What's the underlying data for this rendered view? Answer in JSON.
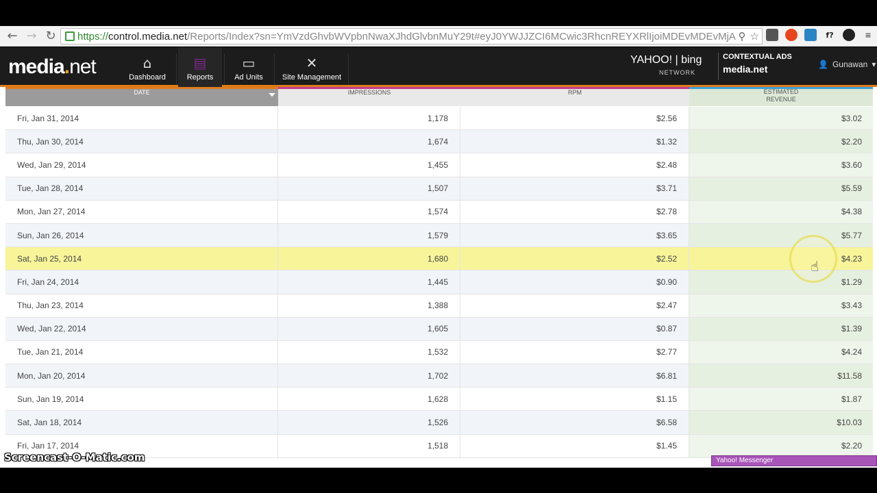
{
  "browser": {
    "url_scheme": "https://",
    "url_host": "control.media.net",
    "url_path": "/Reports/Index?sn=YmVzdGhvbWVpbnNwaXJhdGlvbnMuY29t#eyJ0YWJJZCI6MCwic3RhcnREYXRlIjoiMDEvMDEvMjAxN",
    "back_icon": "←",
    "forward_icon": "→",
    "reload_icon": "↻",
    "search_icon": "⚲",
    "star_icon": "☆"
  },
  "header": {
    "logo_text": "media",
    "logo_dot": ".",
    "logo_net": "net",
    "nav": [
      {
        "label": "Dashboard",
        "icon": "⌂"
      },
      {
        "label": "Reports",
        "icon": "▤"
      },
      {
        "label": "Ad Units",
        "icon": "▭"
      },
      {
        "label": "Site Management",
        "icon": "✕"
      }
    ],
    "partner_title": "YAHOO! | bing",
    "partner_sub": "NETWORK",
    "contextual_title": "CONTEXTUAL ADS",
    "contextual_brand": "media.net",
    "user_name": "Gunawan",
    "user_icon": "👤"
  },
  "table": {
    "headers": {
      "date": "DATE",
      "impressions": "IMPRESSIONS",
      "rpm": "RPM",
      "revenue_top": "ESTIMATED",
      "revenue": "REVENUE"
    },
    "rows": [
      {
        "date": "Fri, Jan 31, 2014",
        "impressions": "1,178",
        "rpm": "$2.56",
        "revenue": "$3.02"
      },
      {
        "date": "Thu, Jan 30, 2014",
        "impressions": "1,674",
        "rpm": "$1.32",
        "revenue": "$2.20"
      },
      {
        "date": "Wed, Jan 29, 2014",
        "impressions": "1,455",
        "rpm": "$2.48",
        "revenue": "$3.60"
      },
      {
        "date": "Tue, Jan 28, 2014",
        "impressions": "1,507",
        "rpm": "$3.71",
        "revenue": "$5.59"
      },
      {
        "date": "Mon, Jan 27, 2014",
        "impressions": "1,574",
        "rpm": "$2.78",
        "revenue": "$4.38"
      },
      {
        "date": "Sun, Jan 26, 2014",
        "impressions": "1,579",
        "rpm": "$3.65",
        "revenue": "$5.77"
      },
      {
        "date": "Sat, Jan 25, 2014",
        "impressions": "1,680",
        "rpm": "$2.52",
        "revenue": "$4.23"
      },
      {
        "date": "Fri, Jan 24, 2014",
        "impressions": "1,445",
        "rpm": "$0.90",
        "revenue": "$1.29"
      },
      {
        "date": "Thu, Jan 23, 2014",
        "impressions": "1,388",
        "rpm": "$2.47",
        "revenue": "$3.43"
      },
      {
        "date": "Wed, Jan 22, 2014",
        "impressions": "1,605",
        "rpm": "$0.87",
        "revenue": "$1.39"
      },
      {
        "date": "Tue, Jan 21, 2014",
        "impressions": "1,532",
        "rpm": "$2.77",
        "revenue": "$4.24"
      },
      {
        "date": "Mon, Jan 20, 2014",
        "impressions": "1,702",
        "rpm": "$6.81",
        "revenue": "$11.58"
      },
      {
        "date": "Sun, Jan 19, 2014",
        "impressions": "1,628",
        "rpm": "$1.15",
        "revenue": "$1.87"
      },
      {
        "date": "Sat, Jan 18, 2014",
        "impressions": "1,526",
        "rpm": "$6.58",
        "revenue": "$10.03"
      },
      {
        "date": "Fri, Jan 17, 2014",
        "impressions": "1,518",
        "rpm": "$1.45",
        "revenue": "$2.20"
      }
    ]
  },
  "overlay": {
    "messenger": "Yahoo! Messenger",
    "watermark": "Screencast-O-Matic.com"
  },
  "colors": {
    "accent_orange": "#e07b1a",
    "accent_magenta": "#c33e8f",
    "accent_blue": "#3ba0d8",
    "highlight_row": "#f7f49a"
  }
}
